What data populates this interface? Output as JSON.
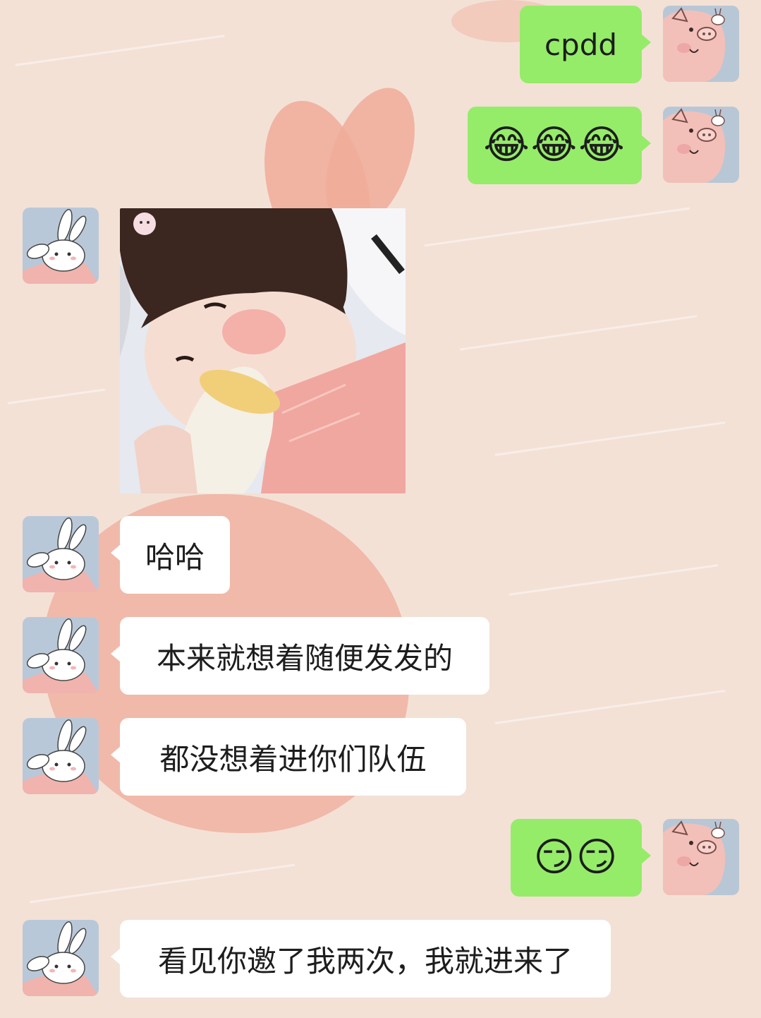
{
  "chat": {
    "messages": [
      {
        "id": "m1",
        "sender": "me",
        "type": "text",
        "text": "cpdd"
      },
      {
        "id": "m2",
        "sender": "me",
        "type": "emoji",
        "text": "😂😂😂"
      },
      {
        "id": "m3",
        "sender": "friend",
        "type": "image",
        "image": "baby-drinking-bottle-sticker"
      },
      {
        "id": "m4",
        "sender": "friend",
        "type": "text",
        "text": "哈哈"
      },
      {
        "id": "m5",
        "sender": "friend",
        "type": "text",
        "text": "本来就想着随便发发的"
      },
      {
        "id": "m6",
        "sender": "friend",
        "type": "text",
        "text": "都没想着进你们队伍"
      },
      {
        "id": "m7",
        "sender": "me",
        "type": "emoji",
        "text": "😏😏"
      },
      {
        "id": "m8",
        "sender": "friend",
        "type": "text",
        "text": "看见你邀了我两次，我就进来了"
      }
    ]
  },
  "avatars": {
    "me": "pig-avatar",
    "friend": "bunny-avatar"
  },
  "colors": {
    "sent_bubble": "#95ec69",
    "received_bubble": "#ffffff",
    "wallpaper": "#f3e1d6"
  }
}
